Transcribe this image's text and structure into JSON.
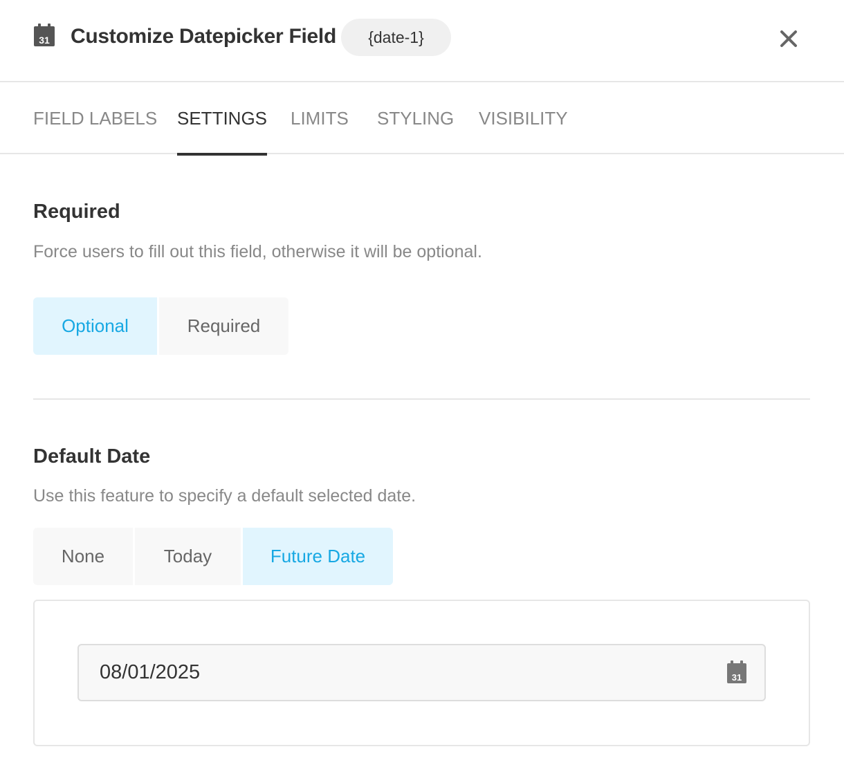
{
  "header": {
    "title": "Customize Datepicker Field",
    "tag": "{date-1}",
    "icon": "calendar-icon",
    "icon_day": "31",
    "close_icon": "close-icon"
  },
  "tabs": [
    {
      "label": "FIELD LABELS",
      "active": false
    },
    {
      "label": "SETTINGS",
      "active": true
    },
    {
      "label": "LIMITS",
      "active": false
    },
    {
      "label": "STYLING",
      "active": false
    },
    {
      "label": "VISIBILITY",
      "active": false
    }
  ],
  "required_section": {
    "title": "Required",
    "description": "Force users to fill out this field, otherwise it will be optional.",
    "options": [
      {
        "label": "Optional",
        "selected": true
      },
      {
        "label": "Required",
        "selected": false
      }
    ]
  },
  "default_date_section": {
    "title": "Default Date",
    "description": "Use this feature to specify a default selected date.",
    "options": [
      {
        "label": "None",
        "selected": false
      },
      {
        "label": "Today",
        "selected": false
      },
      {
        "label": "Future Date",
        "selected": true
      }
    ],
    "date_value": "08/01/2025",
    "date_icon_day": "31"
  },
  "colors": {
    "accent": "#17a8e3",
    "selected_bg": "#e1f5fe",
    "segment_bg": "#f8f8f8",
    "border": "#e6e6e6",
    "text": "#333333",
    "muted": "#888888"
  }
}
